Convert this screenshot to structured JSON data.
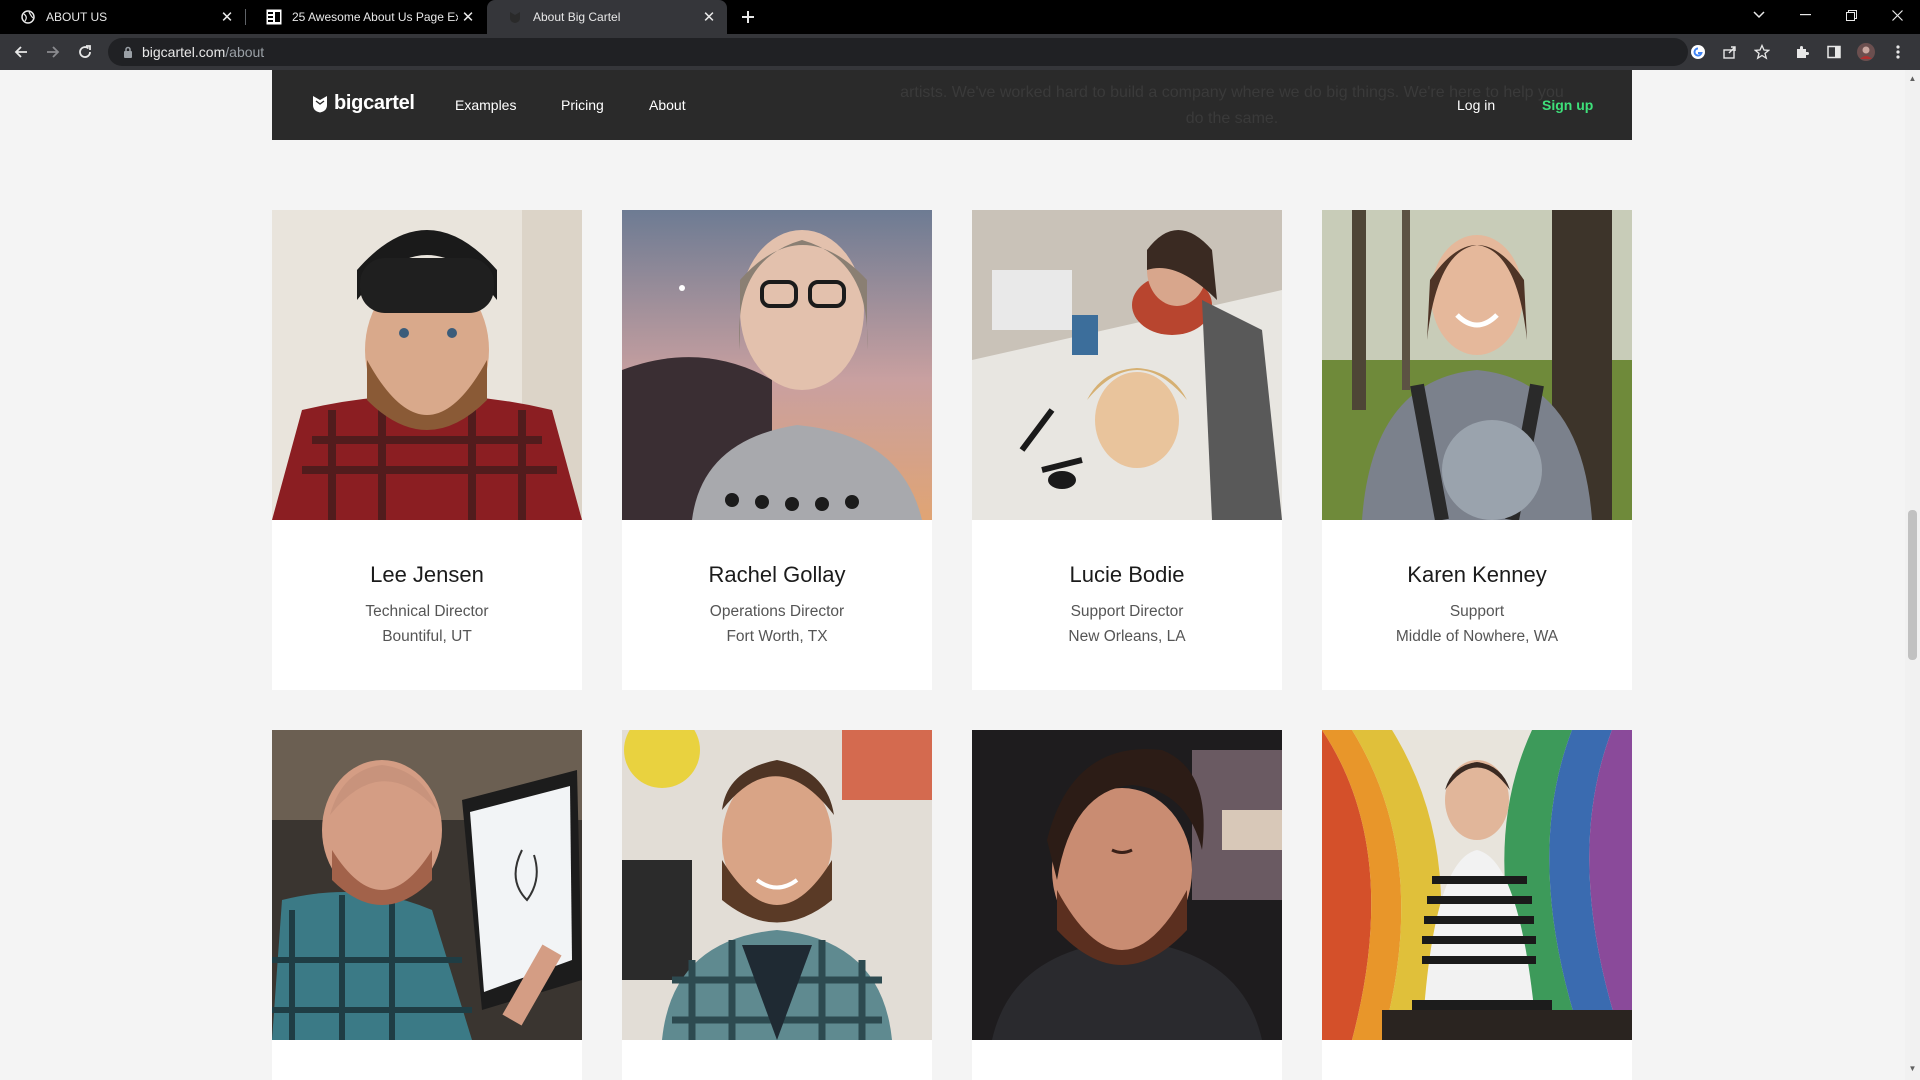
{
  "browser": {
    "tabs": [
      {
        "title": "ABOUT US",
        "active": false
      },
      {
        "title": "25 Awesome About Us Page Exa",
        "active": false
      },
      {
        "title": "About Big Cartel",
        "active": true
      }
    ],
    "url_host": "bigcartel.com",
    "url_path": "/about"
  },
  "site": {
    "brand": "bigcartel",
    "nav": {
      "examples": "Examples",
      "pricing": "Pricing",
      "about": "About",
      "login": "Log in",
      "signup": "Sign up"
    },
    "ghost_text": "artists. We've worked hard to build a company where we do big things. We're here to help you do the same."
  },
  "team": [
    {
      "name": "Lee Jensen",
      "role": "Technical Director",
      "location": "Bountiful, UT"
    },
    {
      "name": "Rachel Gollay",
      "role": "Operations Director",
      "location": "Fort Worth, TX"
    },
    {
      "name": "Lucie Bodie",
      "role": "Support Director",
      "location": "New Orleans, LA"
    },
    {
      "name": "Karen Kenney",
      "role": "Support",
      "location": "Middle of Nowhere, WA"
    }
  ],
  "colors": {
    "brand_dark": "#2a2a2a",
    "signup_green": "#3ee07a",
    "page_bg": "#f4f4f4"
  }
}
